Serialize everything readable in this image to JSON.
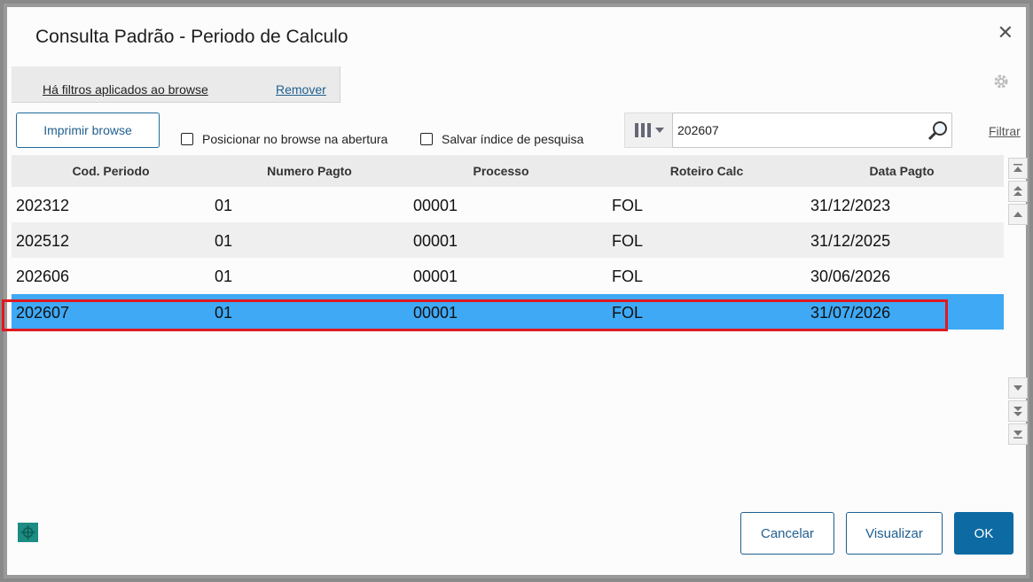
{
  "dialog": {
    "title": "Consulta Padrão - Periodo de Calculo",
    "close_icon": "close-icon"
  },
  "filters": {
    "applied_text": "Há filtros aplicados ao browse",
    "remove_label": "Remover"
  },
  "toolbar": {
    "print_label": "Imprimir browse",
    "checkbox_position_label": "Posicionar no browse na abertura",
    "checkbox_position_checked": false,
    "checkbox_save_index_label": "Salvar índice de pesquisa",
    "checkbox_save_index_checked": false,
    "search_value": "202607",
    "filter_label": "Filtrar"
  },
  "table": {
    "columns": [
      "Cod. Periodo",
      "Numero Pagto",
      "Processo",
      "Roteiro Calc",
      "Data Pagto"
    ],
    "rows": [
      [
        "202312",
        "01",
        "00001",
        "FOL",
        "31/12/2023"
      ],
      [
        "202512",
        "01",
        "00001",
        "FOL",
        "31/12/2025"
      ],
      [
        "202606",
        "01",
        "00001",
        "FOL",
        "30/06/2026"
      ],
      [
        "202607",
        "01",
        "00001",
        "FOL",
        "31/07/2026"
      ]
    ],
    "selected_row_index": 3
  },
  "footer": {
    "cancel_label": "Cancelar",
    "view_label": "Visualizar",
    "ok_label": "OK"
  },
  "colors": {
    "accent": "#0e6aa3",
    "selection": "#3fa9f5",
    "highlight_border": "#e0191f"
  }
}
